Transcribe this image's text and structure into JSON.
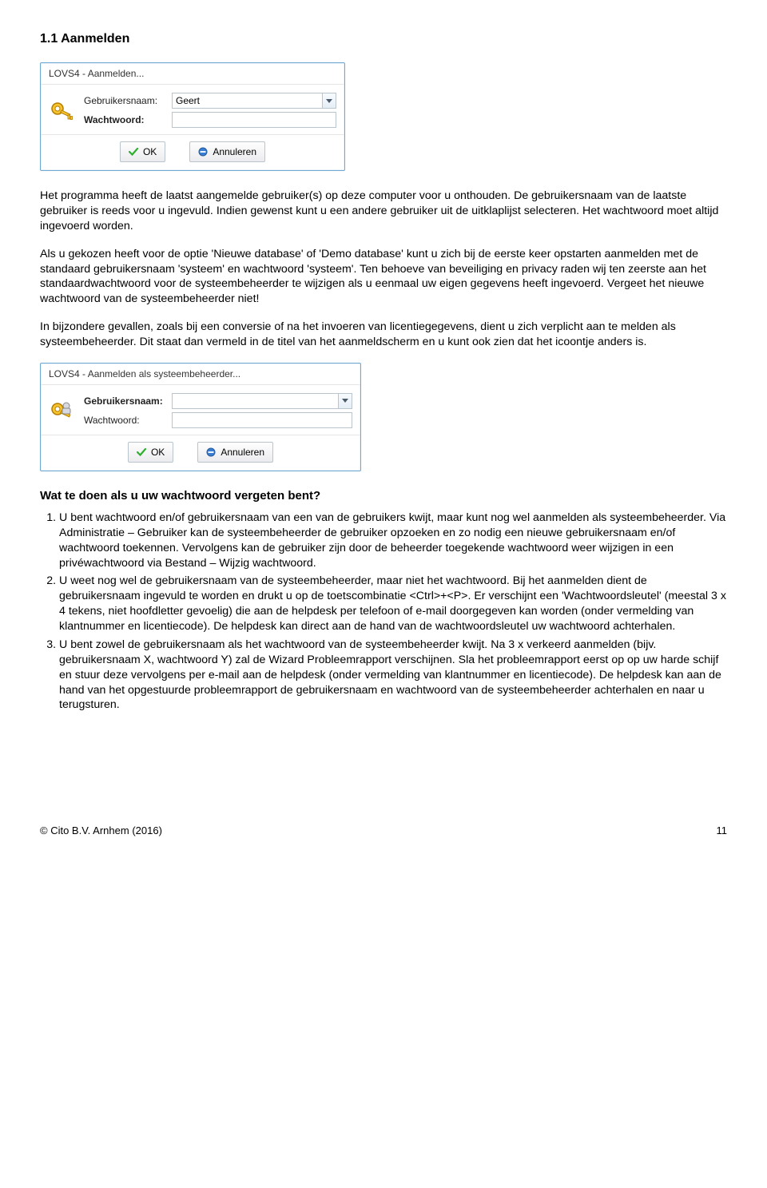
{
  "heading": "1.1    Aanmelden",
  "dialog1": {
    "title": "LOVS4 - Aanmelden...",
    "label_user": "Gebruikersnaam:",
    "label_pw": "Wachtwoord:",
    "user_value": "Geert",
    "btn_ok": "OK",
    "btn_cancel": "Annuleren"
  },
  "para1": "Het programma heeft de laatst aangemelde gebruiker(s) op deze computer voor u onthouden. De gebruikersnaam van de laatste gebruiker is reeds voor u ingevuld. Indien gewenst kunt u een andere gebruiker uit de uitklaplijst selecteren. Het wachtwoord moet altijd ingevoerd worden.",
  "para2": "Als u gekozen heeft voor de optie 'Nieuwe database' of 'Demo database' kunt u zich bij de eerste keer opstarten aanmelden met de standaard gebruikersnaam 'systeem' en wachtwoord 'systeem'. Ten behoeve van beveiliging en privacy raden wij ten zeerste aan het standaardwachtwoord voor de systeembeheerder te wijzigen als u eenmaal uw eigen gegevens heeft ingevoerd. Vergeet het nieuwe wachtwoord van de systeembeheerder niet!",
  "para3": "In bijzondere gevallen, zoals bij een conversie of na het invoeren van licentiegegevens, dient u zich verplicht aan te melden als systeembeheerder. Dit staat dan vermeld in de titel van het aanmeldscherm en u kunt ook zien dat het icoontje anders is.",
  "dialog2": {
    "title": "LOVS4 - Aanmelden als systeembeheerder...",
    "label_user": "Gebruikersnaam:",
    "label_pw": "Wachtwoord:",
    "user_value": "",
    "btn_ok": "OK",
    "btn_cancel": "Annuleren"
  },
  "subheading": "Wat te doen als u uw wachtwoord vergeten bent?",
  "steps": [
    "U bent wachtwoord en/of gebruikersnaam van een van de gebruikers kwijt, maar kunt nog wel aanmelden als systeembeheerder.\nVia Administratie – Gebruiker kan de systeembeheerder de gebruiker opzoeken en zo nodig een nieuwe gebruikersnaam en/of wachtwoord toekennen. Vervolgens kan de gebruiker zijn door de beheerder toegekende wachtwoord weer wijzigen in een privéwachtwoord via Bestand – Wijzig wachtwoord.",
    "U weet nog wel de gebruikersnaam van de systeembeheerder, maar niet het wachtwoord.\nBij het aanmelden dient de gebruikersnaam ingevuld te worden en drukt u op de toetscombinatie <Ctrl>+<P>. Er verschijnt een 'Wachtwoordsleutel' (meestal 3 x 4 tekens, niet hoofdletter gevoelig) die aan de helpdesk per telefoon of e-mail doorgegeven kan worden (onder vermelding van klantnummer en licentiecode). De helpdesk kan direct aan de hand van de wachtwoordsleutel uw wachtwoord achterhalen.",
    "U bent zowel de gebruikersnaam als het wachtwoord van de systeembeheerder kwijt.\nNa 3 x verkeerd aanmelden (bijv. gebruikersnaam X, wachtwoord Y) zal de Wizard Probleemrapport verschijnen. Sla het probleemrapport eerst op op uw harde schijf en stuur deze vervolgens per e-mail aan de helpdesk (onder vermelding van klantnummer en licentiecode). De helpdesk kan aan de hand van het opgestuurde probleemrapport de gebruikersnaam en wachtwoord van de systeembeheerder achterhalen en naar u terugsturen."
  ],
  "footer_left": "© Cito B.V. Arnhem (2016)",
  "footer_right": "11"
}
